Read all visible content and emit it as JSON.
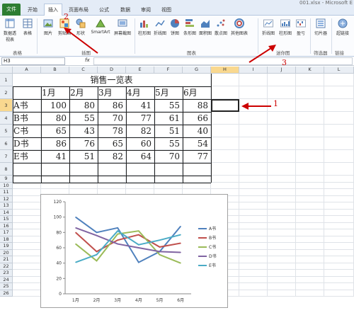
{
  "window": {
    "title_fragment": "001.xlsx - Microsoft E"
  },
  "tabs": [
    "文件",
    "开始",
    "插入",
    "页面布局",
    "公式",
    "数据",
    "审阅",
    "视图"
  ],
  "ribbon": {
    "buttons": [
      "数据透视表",
      "表格",
      "图片",
      "剪贴画",
      "形状",
      "SmartArt",
      "屏幕截图",
      "柱形图",
      "折线图",
      "饼图",
      "条形图",
      "面积图",
      "散点图",
      "其他图表",
      "折线图",
      "柱形图",
      "盈亏",
      "切片器",
      "超链接"
    ],
    "groups": [
      "表格",
      "插图",
      "图表",
      "迷你图",
      "筛选器",
      "链接"
    ]
  },
  "formula_bar": {
    "name_box": "H3",
    "fx_label": "fx",
    "formula": ""
  },
  "sheet": {
    "columns": [
      "A",
      "B",
      "C",
      "D",
      "E",
      "F",
      "G",
      "H",
      "I",
      "J",
      "K",
      "L"
    ],
    "rows": [
      "1",
      "2",
      "3",
      "4",
      "5",
      "6",
      "7",
      "8",
      "9",
      "10",
      "11",
      "12",
      "13",
      "14",
      "15",
      "16",
      "17",
      "18",
      "19",
      "20",
      "21",
      "22",
      "23",
      "24",
      "25",
      "26"
    ],
    "selected_cell": "H3",
    "table_title": "销售一览表",
    "months": [
      "1月",
      "2月",
      "3月",
      "4月",
      "5月",
      "6月"
    ],
    "books": [
      {
        "name": "A书",
        "values": [
          100,
          80,
          86,
          41,
          55,
          88
        ]
      },
      {
        "name": "B书",
        "values": [
          80,
          55,
          70,
          77,
          61,
          66
        ]
      },
      {
        "name": "C书",
        "values": [
          65,
          43,
          78,
          82,
          51,
          40
        ]
      },
      {
        "name": "D书",
        "values": [
          86,
          76,
          65,
          60,
          55,
          54
        ]
      },
      {
        "name": "E书",
        "values": [
          41,
          51,
          82,
          64,
          70,
          77
        ]
      }
    ]
  },
  "chart_data": {
    "type": "line",
    "categories": [
      "1月",
      "2月",
      "3月",
      "4月",
      "5月",
      "6月"
    ],
    "ylim": [
      0,
      120
    ],
    "yticks": [
      0,
      20,
      40,
      60,
      80,
      100,
      120
    ],
    "series": [
      {
        "name": "A书",
        "values": [
          100,
          80,
          86,
          41,
          55,
          88
        ],
        "color": "#4f81bd"
      },
      {
        "name": "B书",
        "values": [
          80,
          55,
          70,
          77,
          61,
          66
        ],
        "color": "#c0504d"
      },
      {
        "name": "C书",
        "values": [
          65,
          43,
          78,
          82,
          51,
          40
        ],
        "color": "#9bbb59"
      },
      {
        "name": "D书",
        "values": [
          86,
          76,
          65,
          60,
          55,
          54
        ],
        "color": "#8064a2"
      },
      {
        "name": "E书",
        "values": [
          41,
          51,
          82,
          64,
          70,
          77
        ],
        "color": "#4bacc6"
      }
    ],
    "legend": "right",
    "grid": false
  },
  "annotations": [
    "1",
    "2",
    "3"
  ],
  "colors": {
    "file_tab": "#2d7d32",
    "arrow": "#cc0000",
    "selection": "#f9d88f"
  }
}
